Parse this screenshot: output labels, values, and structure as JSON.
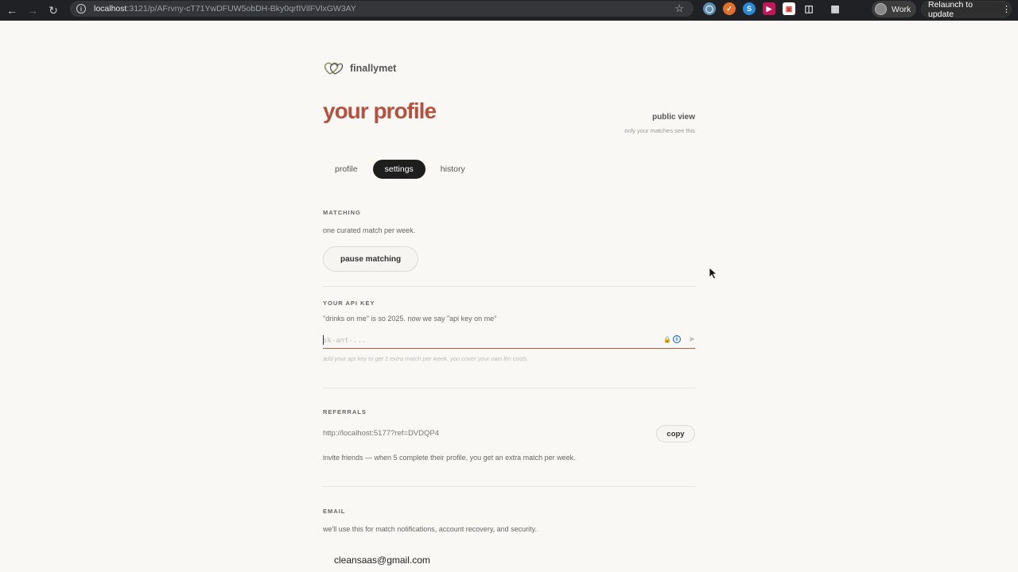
{
  "browser": {
    "url_host": "localhost",
    "url_rest": ":3121/p/AFrvny-cT71YwDFUW5obDH-Bky0qrfIVilFVlxGW3AY",
    "profile_name": "Work",
    "relaunch_label": "Relaunch to update",
    "extensions": [
      "globe-extension",
      "orange-extension",
      "s-extension",
      "red-extension",
      "photo-extension",
      "puzzle-extension",
      "tab-search"
    ]
  },
  "brand": {
    "name": "finallymet"
  },
  "header": {
    "title": "your profile",
    "public_view": "public view",
    "public_sub": "only your matches see this"
  },
  "tabs": [
    {
      "label": "profile",
      "active": false
    },
    {
      "label": "settings",
      "active": true
    },
    {
      "label": "history",
      "active": false
    }
  ],
  "matching": {
    "label": "MATCHING",
    "text": "one curated match per week.",
    "button": "pause matching"
  },
  "api_key": {
    "label": "YOUR API KEY",
    "text": "\"drinks on me\" is so 2025. now we say \"api key on me\"",
    "placeholder": "sk-ant-...",
    "hint": "add your api key to get 1 extra match per week. you cover your own llm costs."
  },
  "referrals": {
    "label": "REFERRALS",
    "link": "http://localhost:5177?ref=DVDQP4",
    "copy_button": "copy",
    "text": "invite friends — when 5 complete their profile, you get an extra match per week."
  },
  "email": {
    "label": "EMAIL",
    "text": "we'll use this for match notifications, account recovery, and security.",
    "value": "cleansaas@gmail.com"
  },
  "colors": {
    "accent": "#b5523f",
    "tab_active_bg": "#1e1e1e",
    "page_bg": "#faf8f5"
  }
}
